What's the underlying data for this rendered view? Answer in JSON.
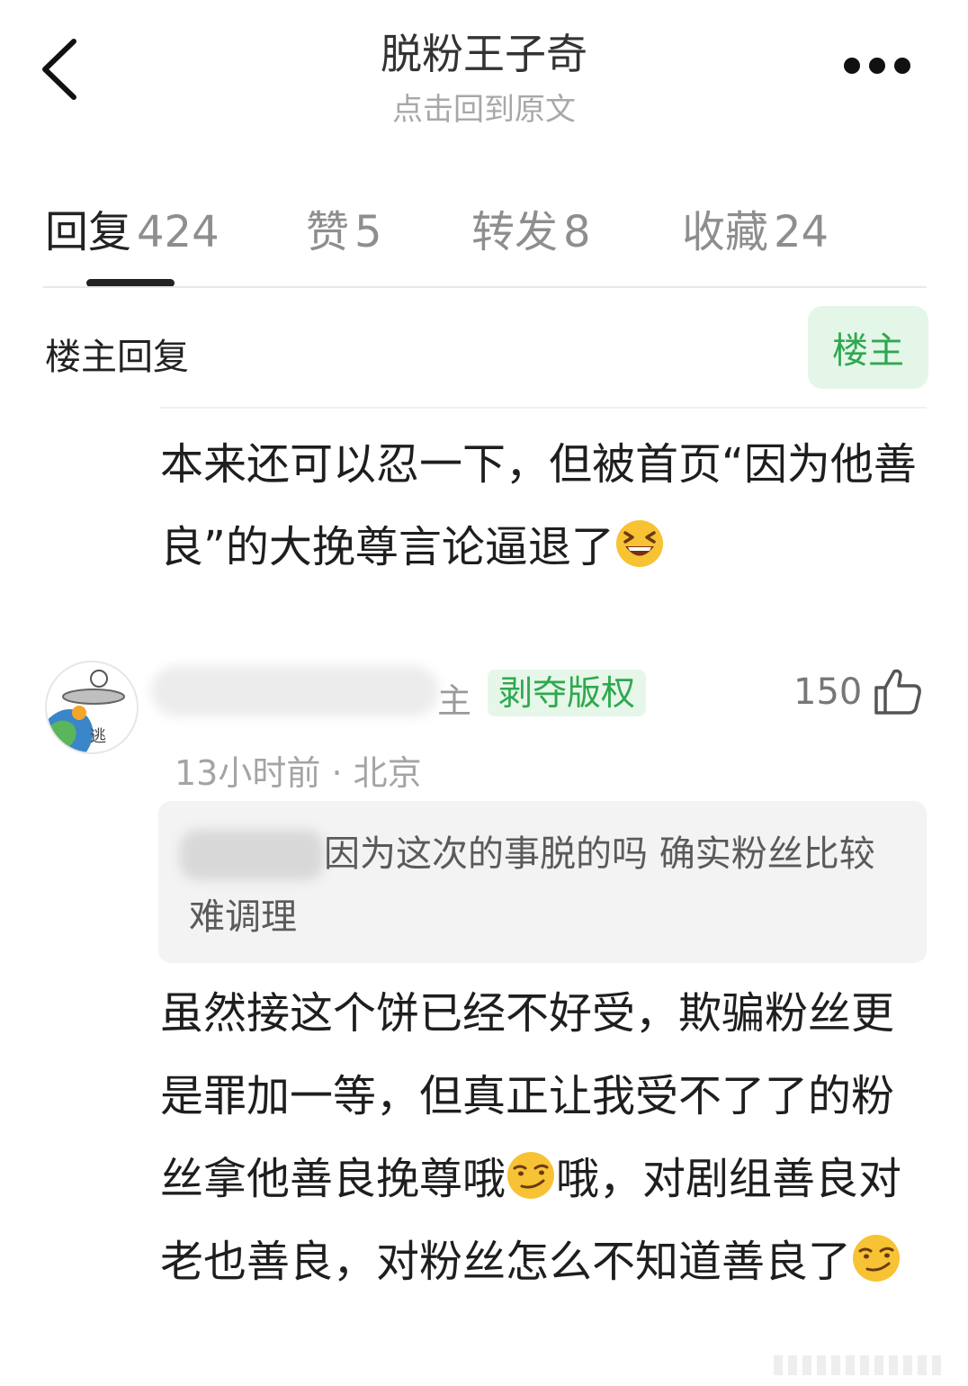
{
  "header": {
    "title": "脱粉王子奇",
    "subtitle": "点击回到原文",
    "back_icon": "chevron-left-icon",
    "more_icon": "more-dots-icon"
  },
  "tabs": [
    {
      "label": "回复",
      "count": "424",
      "active": true
    },
    {
      "label": "赞",
      "count": "5"
    },
    {
      "label": "转发",
      "count": "8"
    },
    {
      "label": "收藏",
      "count": "24"
    }
  ],
  "owner_reply": {
    "heading": "楼主回复",
    "badge": "楼主",
    "text": "本来还可以忍一下，但被首页“因为他善良”的大挽尊言论逼退了",
    "emoji": "laughing-face-emoji"
  },
  "comment": {
    "name_suffix": "主",
    "tag": "剥夺版权",
    "likes": "150",
    "time": "13小时前",
    "location": "北京",
    "separator": "·",
    "quote": "因为这次的事脱的吗 确实粉丝比较难调理",
    "text_part1": "虽然接这个饼已经不好受，欺骗粉丝更是罪加一等，但真正让我受不了了的粉丝拿他善良挽尊哦",
    "text_part2": "哦，对剧组善良对老也善良，对粉丝怎么不知道善良了",
    "emoji": "smirking-face-emoji"
  },
  "colors": {
    "accent_green": "#2fa84f",
    "badge_bg": "#e4f6e8",
    "muted_text": "#a4a4a4"
  }
}
